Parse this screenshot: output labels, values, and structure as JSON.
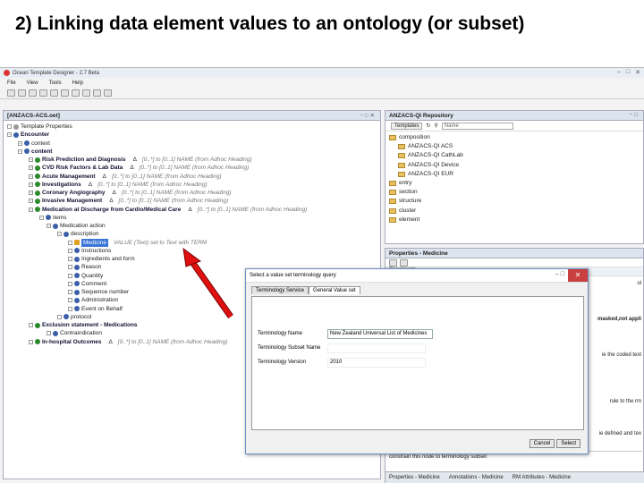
{
  "slide_title": "2) Linking data element values to an ontology (or subset)",
  "app": {
    "window_title": "Ocean Template Designer - 2.7 Beta",
    "menu": [
      "File",
      "View",
      "Tools",
      "Help"
    ],
    "editor_tab": "[ANZACS-ACS.oet]",
    "tree": [
      {
        "label": "Template Properties",
        "bold": false,
        "meta": ""
      },
      {
        "label": "Encounter",
        "bold": true,
        "meta": ""
      },
      {
        "label": "context",
        "bold": false,
        "meta": ""
      },
      {
        "label": "content",
        "bold": true,
        "meta": ""
      },
      {
        "label": "Risk Prediction and Diagnosis",
        "bold": true,
        "meta": "[0..*] to [0..1]  NAME (from Adhoc Heading)"
      },
      {
        "label": "CVD Risk Factors & Lab Data",
        "bold": true,
        "meta": "[0..*] to [0..1]  NAME (from Adhoc Heading)"
      },
      {
        "label": "Acute Management",
        "bold": true,
        "meta": "[0..*] to [0..1]  NAME (from Adhoc Heading)"
      },
      {
        "label": "Investigations",
        "bold": true,
        "meta": "[0..*] to [0..1]  NAME (from Adhoc Heading)"
      },
      {
        "label": "Coronary Angiography",
        "bold": true,
        "meta": "[0..*] to [0..1]  NAME (from Adhoc Heading)"
      },
      {
        "label": "Invasive Management",
        "bold": true,
        "meta": "[0..*] to [0..1]  NAME (from Adhoc Heading)"
      },
      {
        "label": "Medication at Discharge from Cardio/Medical Care",
        "bold": true,
        "meta": "[0..*] to [0..1]  NAME (from Adhoc Heading)"
      },
      {
        "label": "items",
        "bold": false,
        "meta": ""
      },
      {
        "label": "Medication action",
        "bold": false,
        "meta": ""
      },
      {
        "label": "description",
        "bold": false,
        "meta": ""
      },
      {
        "label": "Medicine",
        "bold": false,
        "meta": "VALUE (Text) set to Text with TERM",
        "selected": true
      },
      {
        "label": "Instructions",
        "bold": false,
        "meta": ""
      },
      {
        "label": "Ingredients and form",
        "bold": false,
        "meta": ""
      },
      {
        "label": "Reason",
        "bold": false,
        "meta": ""
      },
      {
        "label": "Quantity",
        "bold": false,
        "meta": ""
      },
      {
        "label": "Comment",
        "bold": false,
        "meta": ""
      },
      {
        "label": "Sequence number",
        "bold": false,
        "meta": ""
      },
      {
        "label": "Administration",
        "bold": false,
        "meta": ""
      },
      {
        "label": "Event on Behalf",
        "bold": false,
        "meta": ""
      },
      {
        "label": "protocol",
        "bold": false,
        "meta": ""
      },
      {
        "label": "Exclusion statement - Medications",
        "bold": true,
        "meta": ""
      },
      {
        "label": "Contraindication",
        "bold": false,
        "meta": ""
      },
      {
        "label": "In-hospital Outcomes",
        "bold": true,
        "meta": "[0..*] to [0..1]  NAME (from Adhoc Heading)"
      }
    ],
    "repo": {
      "tab": "ANZACS-QI Repository",
      "template_btn": "Templates",
      "search_placeholder": "Name",
      "items": [
        "composition",
        "ANZACS-QI ACS",
        "ANZACS-QI CathLab",
        "ANZACS-QI Device",
        "ANZACS-QI EUR",
        "entry",
        "section",
        "structure",
        "cluster",
        "element"
      ]
    },
    "props": {
      "tab": "Properties - Medicine",
      "constraints": "Constraints",
      "snippet_right_1": "ol",
      "snippet_right_2": "masked,not appli",
      "snippet_right_3": "ie the coded text",
      "snippet_right_4": "rule to the rm",
      "snippet_right_5": "ie defined and tex",
      "bottom_tabs": [
        "Properties - Medicine",
        "Annotations - Medicine",
        "RM Attributes - Medicine"
      ]
    },
    "dialog": {
      "title": "Select a value set terminology query",
      "tabs": [
        "Terminology Service",
        "General Value set"
      ],
      "fields": [
        {
          "label": "Terminology Name",
          "value": "New Zealand Universal List of Medicines"
        },
        {
          "label": "Terminology Subset Name",
          "value": ""
        },
        {
          "label": "Terminology Version",
          "value": "2010"
        }
      ],
      "cancel": "Cancel",
      "select": "Select"
    },
    "status_text": "constrain this node to terminology subset"
  }
}
